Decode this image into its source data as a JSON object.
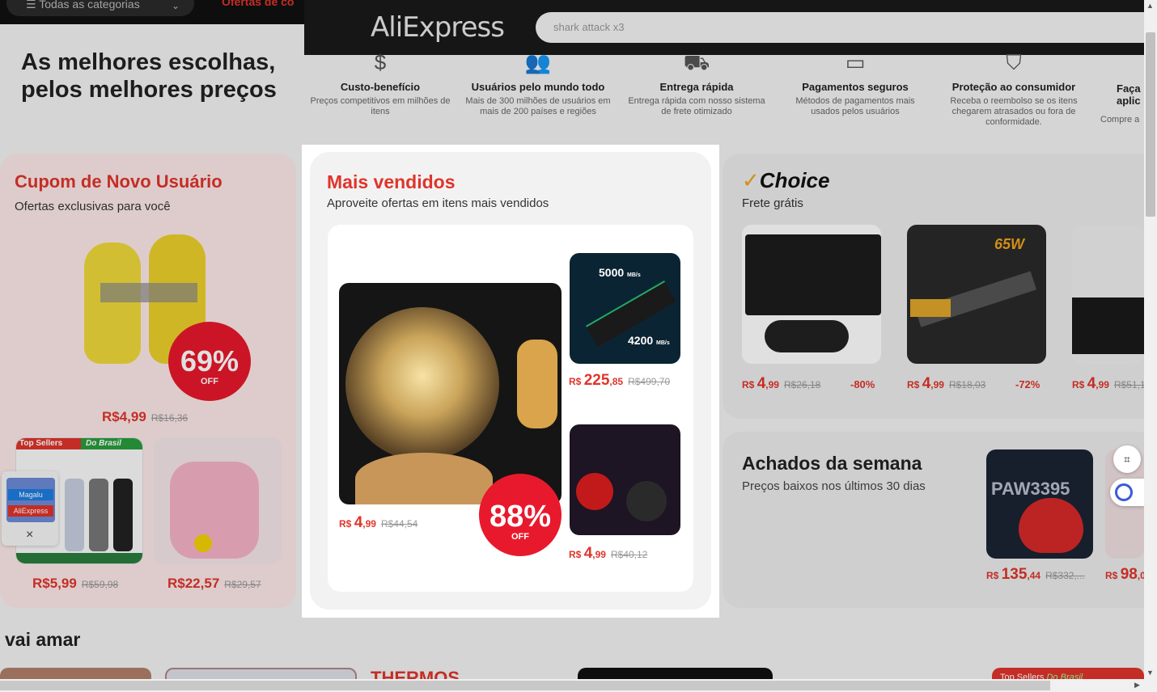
{
  "topbar": {
    "all_categories": "Todas as categorias",
    "offers": "Ofertas de co"
  },
  "header": {
    "logo": "AliExpress",
    "search_placeholder": "shark attack x3"
  },
  "hero": {
    "line1": "As melhores escolhas,",
    "line2": "pelos melhores preços"
  },
  "features": [
    {
      "icon": "dollar-icon",
      "title": "Custo-benefício",
      "desc": "Preços competitivos em milhões de itens"
    },
    {
      "icon": "users-icon",
      "title": "Usuários pelo mundo todo",
      "desc": "Mais de 300 milhões de usuários em mais de 200 países e regiões"
    },
    {
      "icon": "truck-icon",
      "title": "Entrega rápida",
      "desc": "Entrega rápida com nosso sistema de frete otimizado"
    },
    {
      "icon": "card-icon",
      "title": "Pagamentos seguros",
      "desc": "Métodos de pagamentos mais usados pelos usuários"
    },
    {
      "icon": "shield-icon",
      "title": "Proteção ao consumidor",
      "desc": "Receba o reembolso se os itens chegarem atrasados ou fora de conformidade."
    },
    {
      "icon": "app-icon",
      "title": "Faça aplic",
      "desc": "Compre a"
    }
  ],
  "coupon": {
    "title": "Cupom de Novo Usuário",
    "subtitle": "Ofertas exclusivas para você",
    "badge_pct": "69%",
    "badge_off": "OFF",
    "main_price": "R$4,99",
    "main_old": "R$16,36",
    "items": [
      {
        "price": "R$5,99",
        "old": "R$59,98",
        "tag1": "Top Sellers",
        "tag2": "Do Brasil"
      },
      {
        "price": "R$22,57",
        "old": "R$29,57"
      }
    ]
  },
  "modal": {
    "title": "Mais vendidos",
    "subtitle": "Aproveite ofertas em itens mais vendidos",
    "badge_pct": "88%",
    "badge_off": "OFF",
    "main": {
      "cur": "R$",
      "int": "4",
      "dec": ",99",
      "old": "R$44,54"
    },
    "ssd": {
      "cur": "R$",
      "int": "225",
      "dec": ",85",
      "old": "R$499,70",
      "speed1": "5000",
      "speed2": "4200",
      "unit": "MB/s"
    },
    "earbuds": {
      "cur": "R$",
      "int": "4",
      "dec": ",99",
      "old": "R$40,12"
    }
  },
  "choice": {
    "logo": "Choice",
    "subtitle": "Frete grátis",
    "items": [
      {
        "cur": "R$",
        "int": "4",
        "dec": ",99",
        "old": "R$26,18",
        "disc": "-80%"
      },
      {
        "cur": "R$",
        "int": "4",
        "dec": ",99",
        "old": "R$18,03",
        "disc": "-72%",
        "watts": "65W"
      },
      {
        "cur": "R$",
        "int": "4",
        "dec": ",99",
        "old": "R$51,1"
      }
    ]
  },
  "week": {
    "title": "Achados da semana",
    "subtitle": "Preços baixos nos últimos 30 dias",
    "items": [
      {
        "cur": "R$",
        "int": "135",
        "dec": ",44",
        "old": "R$332,...",
        "overlay": "PAW3395"
      },
      {
        "cur": "R$",
        "int": "98",
        "dec": ",0"
      }
    ]
  },
  "magalu": {
    "line1": "Magalu",
    "line2": "AliExpress",
    "close": "×"
  },
  "section": {
    "title": "vai amar"
  },
  "bottom": {
    "thermo": "THERMOS",
    "tag1": "Top Sellers",
    "tag2": "Do Brasil"
  }
}
